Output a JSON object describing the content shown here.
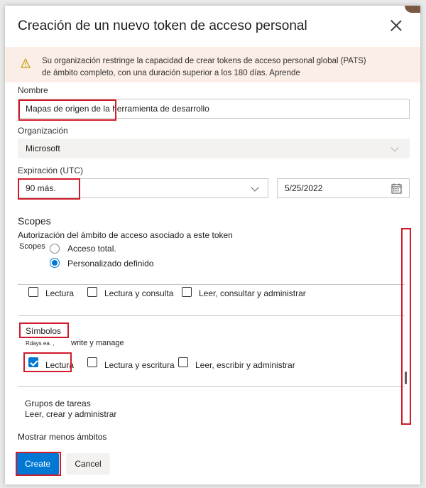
{
  "dialog": {
    "title": "Creación de un nuevo token de acceso personal",
    "warning": "Su organización restringe la capacidad de crear tokens de acceso personal global (PATS) de ámbito completo, con una duración superior a los 180 días. Aprende"
  },
  "form": {
    "name_label": "Nombre",
    "name_value": "Mapas de origen de la herramienta de desarrollo",
    "org_label": "Organización",
    "org_value": "Microsoft",
    "expiration_label": "Expiración (UTC)",
    "expiration_value": "90 más.",
    "expiration_date": "5/25/2022"
  },
  "scopes": {
    "title": "Scopes",
    "description": "Autorización del ámbito de acceso asociado a este token",
    "scopes_label": "Scopes",
    "option_full": "Acceso total.",
    "option_custom": "Personalizado definido",
    "first_row": [
      "Lectura",
      "Lectura y consulta",
      "Leer, consultar y administrar"
    ],
    "symbols_title": "Símbolos",
    "symbols_desc_small": "Rdays ea. ,",
    "symbols_desc": "write y manage",
    "symbols_row": [
      "Lectura",
      "Lectura y escritura",
      "Leer, escribir y administrar"
    ],
    "task_groups_title": "Grupos de tareas",
    "task_groups_desc": "Leer, crear y administrar",
    "show_less": "Mostrar menos ámbitos"
  },
  "buttons": {
    "create": "Create",
    "cancel": "Cancel"
  },
  "colors": {
    "accent": "#0078d4",
    "highlight": "#d11a2a",
    "warning_bg": "#fbeee6"
  }
}
